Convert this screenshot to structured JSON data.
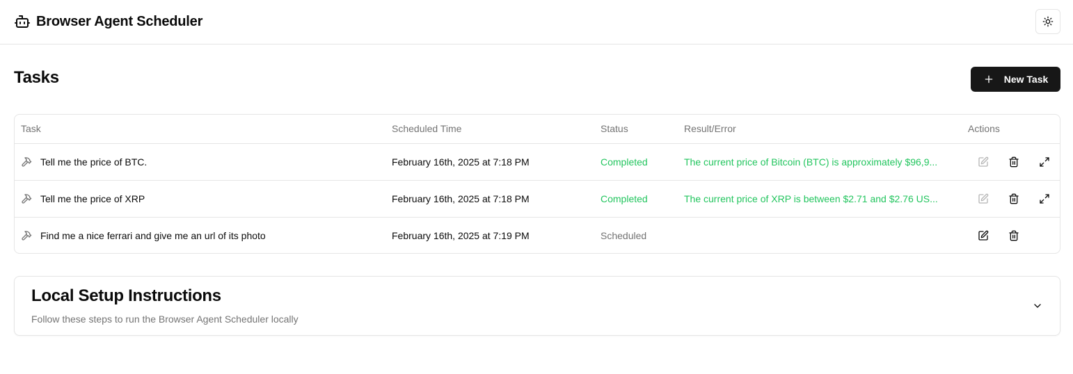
{
  "app": {
    "title": "Browser Agent Scheduler",
    "icon": "bot-icon",
    "theme_toggle_icon": "sun-icon"
  },
  "page": {
    "title": "Tasks",
    "new_task_label": "New Task",
    "new_task_icon": "plus-icon"
  },
  "table": {
    "headers": [
      "Task",
      "Scheduled Time",
      "Status",
      "Result/Error",
      "Actions"
    ],
    "rows": [
      {
        "task": "Tell me the price of BTC.",
        "time": "February 16th, 2025 at 7:18 PM",
        "status": "Completed",
        "result": "The current price of Bitcoin (BTC) is approximately $96,9..."
      },
      {
        "task": "Tell me the price of XRP",
        "time": "February 16th, 2025 at 7:18 PM",
        "status": "Completed",
        "result": "The current price of XRP is between $2.71 and $2.76 US..."
      },
      {
        "task": "Find me a nice ferrari and give me an url of its photo",
        "time": "February 16th, 2025 at 7:19 PM",
        "status": "Scheduled",
        "result": ""
      }
    ]
  },
  "setup": {
    "title": "Local Setup Instructions",
    "subtitle": "Follow these steps to run the Browser Agent Scheduler locally"
  },
  "colors": {
    "completed": "#22c55e",
    "scheduled": "#737373",
    "primary_button": "#171717",
    "border": "#e5e5e5"
  }
}
